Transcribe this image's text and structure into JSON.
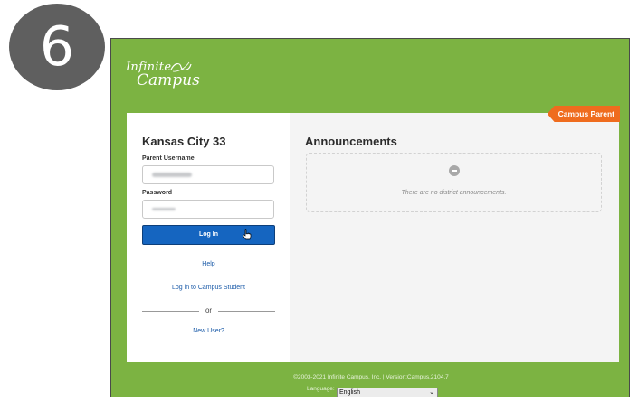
{
  "step_badge": "6",
  "logo": {
    "line1": "Infinite",
    "line2": "Campus"
  },
  "portal_tag": "Campus Parent",
  "login": {
    "district": "Kansas City 33",
    "username_label": "Parent Username",
    "password_label": "Password",
    "login_button": "Log In",
    "help_link": "Help",
    "student_link": "Log in to Campus Student",
    "or_text": "or",
    "new_user_link": "New User?"
  },
  "announcements": {
    "title": "Announcements",
    "empty_text": "There are no district announcements."
  },
  "footer": {
    "copyright": "©2003-2021 Infinite Campus, Inc. | Version:Campus.2104.7",
    "language_label": "Language:",
    "language_value": "English"
  },
  "colors": {
    "frame_green": "#7cb342",
    "button_blue": "#1565c0",
    "tag_orange": "#ef6c1e"
  }
}
